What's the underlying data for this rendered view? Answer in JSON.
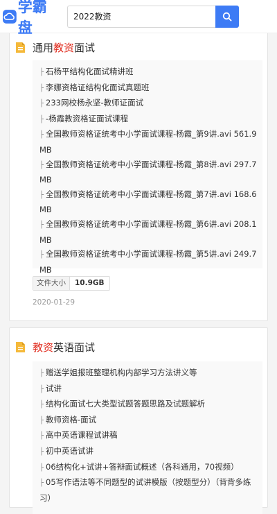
{
  "header": {
    "logo_text": "学霸盘",
    "search_value": "2022教资",
    "accent_color": "#3d7bf5"
  },
  "results": [
    {
      "title_prefix": "通用",
      "title_highlight": "教资",
      "title_suffix": "面试",
      "files": [
        "石杨平结构化面试精讲班",
        "李娜资格证结构化面试真题班",
        "233网校杨永坚-教师证面试",
        "-杨霞教资格证面试课程",
        "全国教师资格证统考中小学面试课程-杨霞_第9讲.avi 561.9MB",
        "全国教师资格证统考中小学面试课程-杨霞_第8讲.avi 297.7MB",
        "全国教师资格证统考中小学面试课程-杨霞_第7讲.avi 168.6MB",
        "全国教师资格证统考中小学面试课程-杨霞_第6讲.avi 208.1MB",
        "全国教师资格证统考中小学面试课程-杨霞_第5讲.avi 249.7MB"
      ],
      "size_label": "文件大小",
      "size_value": "10.9GB",
      "date": "2020-01-29"
    },
    {
      "title_prefix": "",
      "title_highlight": "教资",
      "title_suffix": "英语面试",
      "files": [
        "赠送学姐报班整理机构内部学习方法讲义等",
        "试讲",
        "结构化面试七大类型试题答题思路及试题解析",
        "教师资格-面试",
        "高中英语课程试讲稿",
        "初中英语试讲",
        "06结构化+试讲+答辩面试概述（各科通用，70视频）",
        "05写作语法等不同题型的试讲模版（按题型分）（背背多练习）"
      ]
    }
  ]
}
